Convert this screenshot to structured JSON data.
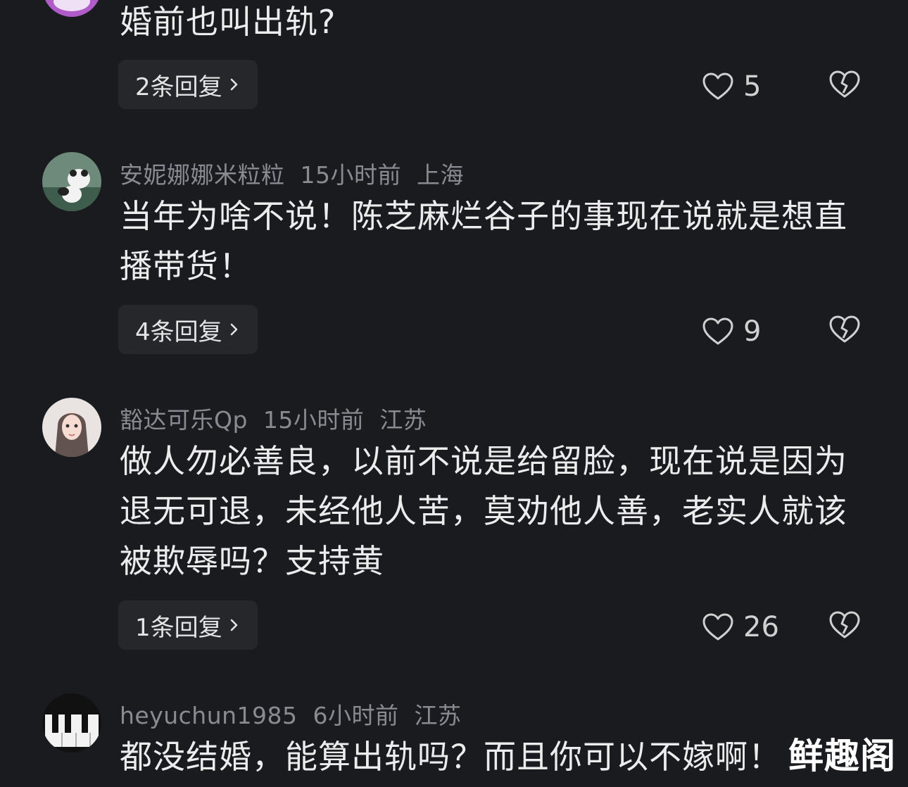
{
  "comments": [
    {
      "text": "婚前也叫出轨?",
      "reply_label": "2条回复",
      "likes": "5"
    },
    {
      "username": "安妮娜娜米粒粒",
      "time": "15小时前",
      "location": "上海",
      "text_lines": [
        "当年为啥不说！陈芝麻烂谷子的事现在说就是想直",
        "播带货！"
      ],
      "reply_label": "4条回复",
      "likes": "9"
    },
    {
      "username": "豁达可乐Qp",
      "time": "15小时前",
      "location": "江苏",
      "text_lines": [
        "做人勿必善良，以前不说是给留脸，现在说是因为",
        "退无可退，未经他人苦，莫劝他人善，老实人就该",
        "被欺辱吗？支持黄"
      ],
      "reply_label": "1条回复",
      "likes": "26"
    },
    {
      "username": "heyuchun1985",
      "time": "6小时前",
      "location": "江苏",
      "text": "都没结婚，能算出轨吗？而且你可以不嫁啊！"
    }
  ],
  "watermark": "鲜趣阁",
  "icons": [
    "heart-icon",
    "broken-heart-icon",
    "chevron-right-icon"
  ],
  "colors": {
    "background": "#1a1b1f",
    "meta": "#8a8b90",
    "text": "#ececec",
    "button": "#26272b"
  }
}
